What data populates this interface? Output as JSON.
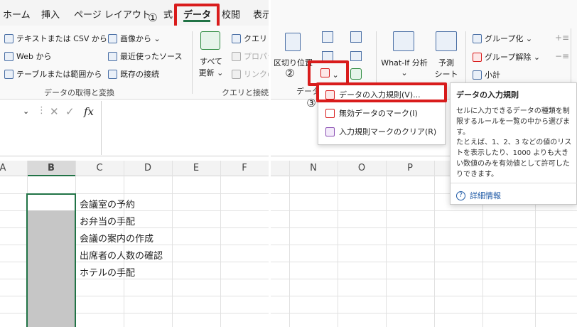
{
  "left": {
    "tabs": [
      "ホーム",
      "挿入",
      "ページ レイアウト",
      "式",
      "データ",
      "校閲",
      "表示"
    ],
    "step1": "①",
    "ribbon": {
      "get_data": [
        "テキストまたは CSV から",
        "Web から",
        "テーブルまたは範囲から"
      ],
      "get_data2": [
        "画像から ⌄",
        "最近使ったソース",
        "既存の接続"
      ],
      "refresh_all": [
        "すべて",
        "更新 ⌄"
      ],
      "queries": [
        "クエリと接続",
        "プロパティ",
        "リンクの編集"
      ]
    },
    "group_labels": [
      "データの取得と変換",
      "クエリと接続"
    ],
    "formula_bar": {
      "fx": "fx",
      "cancel": "✕",
      "enter": "✓"
    },
    "columns": [
      "A",
      "B",
      "C",
      "D",
      "E",
      "F"
    ],
    "rows": [
      "会議室の予約",
      "お弁当の手配",
      "会議の案内の作成",
      "出席者の人数の確認",
      "ホテルの手配"
    ]
  },
  "right": {
    "ribbon": {
      "text_to_columns": "区切り位置",
      "data_tools_group": "データ",
      "whatif": "What-If 分析",
      "forecast": [
        "予測",
        "シート"
      ],
      "outline": [
        "グループ化 ⌄",
        "グループ解除 ⌄",
        "小計"
      ]
    },
    "step2": "②",
    "step3": "③",
    "dropdown": [
      {
        "label": "データの入力規則(V)..."
      },
      {
        "label": "無効データのマーク(I)"
      },
      {
        "label": "入力規則マークのクリア(R)"
      }
    ],
    "tooltip": {
      "title": "データの入力規則",
      "body1": "セルに入力できるデータの種類を制限するルールを一覧の中から選びます。",
      "body2": "たとえば、1、2、3 などの値のリストを表示したり、1000 よりも大きい数値のみを有効値として許可したりできます。",
      "link": "詳細情報"
    },
    "columns": [
      "N",
      "O",
      "P"
    ]
  },
  "colors": {
    "accent_red": "#d91c1c",
    "excel_green": "#217346",
    "selection_gray": "#c6c6c6"
  }
}
